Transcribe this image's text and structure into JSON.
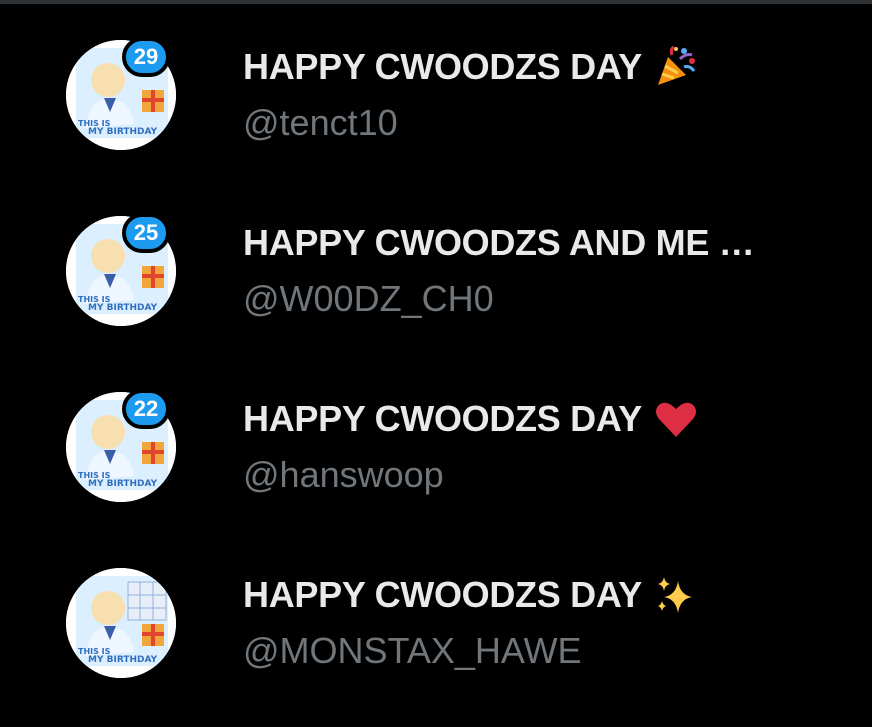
{
  "colors": {
    "background": "#000000",
    "title_text": "#e7e9ea",
    "handle_text": "#71767b",
    "badge": "#1d9bf0",
    "heart": "#dd2e44"
  },
  "accounts": [
    {
      "badge": "29",
      "name": "HAPPY CWOODZS DAY",
      "emoji": "party-popper-icon",
      "handle": "@tenct10"
    },
    {
      "badge": "25",
      "name": "HAPPY CWOODZS AND ME …",
      "emoji": "",
      "handle": "@W00DZ_CH0"
    },
    {
      "badge": "22",
      "name": "HAPPY CWOODZS DAY",
      "emoji": "red-heart-icon",
      "handle": "@hanswoop"
    },
    {
      "badge": "",
      "name": "HAPPY CWOODZS DAY",
      "emoji": "sparkles-icon",
      "handle": "@MONSTAX_HAWE"
    }
  ]
}
